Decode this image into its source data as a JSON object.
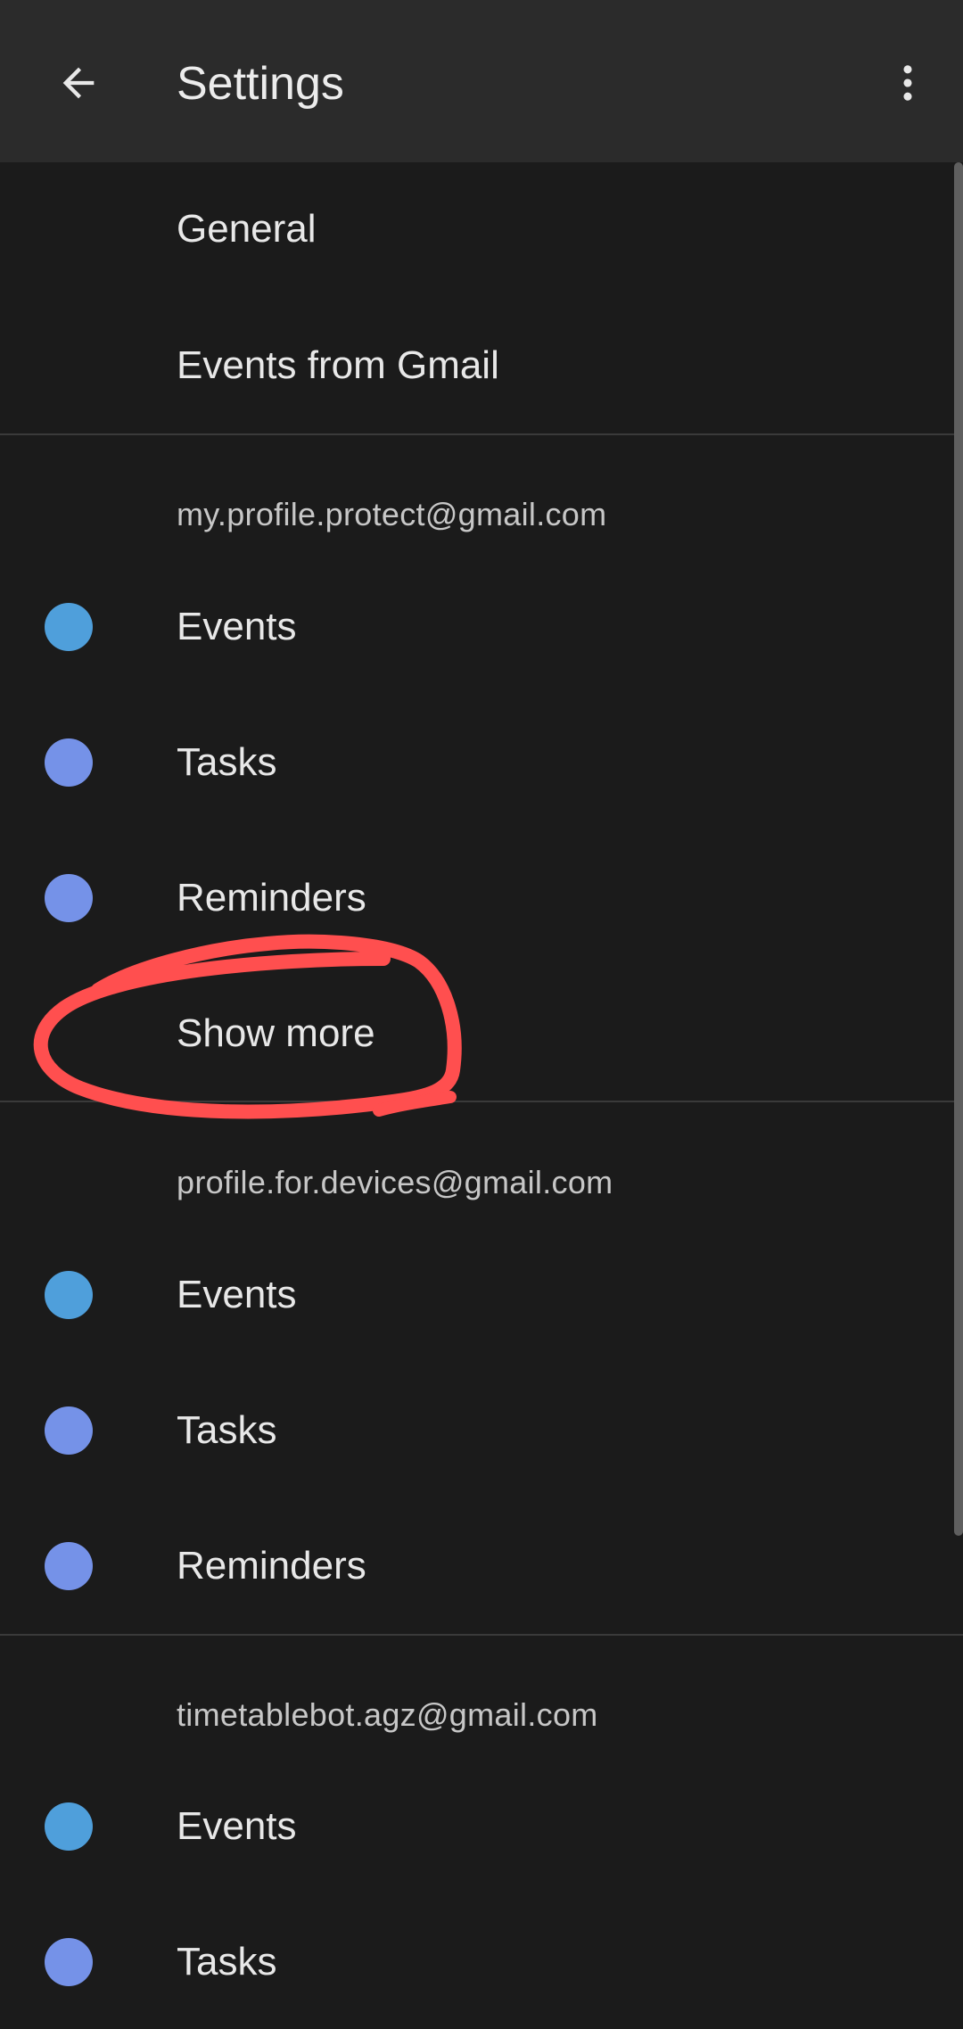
{
  "app_bar": {
    "title": "Settings",
    "back_icon": "arrow-back-icon",
    "overflow_icon": "more-vert-icon"
  },
  "general": {
    "items": [
      {
        "label": "General"
      },
      {
        "label": "Events from Gmail"
      }
    ]
  },
  "accounts": [
    {
      "email": "my.profile.protect@gmail.com",
      "calendars": [
        {
          "label": "Events",
          "color": "#4f9fdb"
        },
        {
          "label": "Tasks",
          "color": "#7592e8"
        },
        {
          "label": "Reminders",
          "color": "#7592e8"
        }
      ],
      "show_more_label": "Show more"
    },
    {
      "email": "profile.for.devices@gmail.com",
      "calendars": [
        {
          "label": "Events",
          "color": "#4f9fdb"
        },
        {
          "label": "Tasks",
          "color": "#7592e8"
        },
        {
          "label": "Reminders",
          "color": "#7592e8"
        }
      ]
    },
    {
      "email": "timetablebot.agz@gmail.com",
      "calendars": [
        {
          "label": "Events",
          "color": "#4f9fdb"
        },
        {
          "label": "Tasks",
          "color": "#7592e8"
        }
      ]
    }
  ],
  "colors": {
    "background": "#1b1b1b",
    "app_bar": "#2b2b2b",
    "annotation": "#ff4f4f"
  }
}
